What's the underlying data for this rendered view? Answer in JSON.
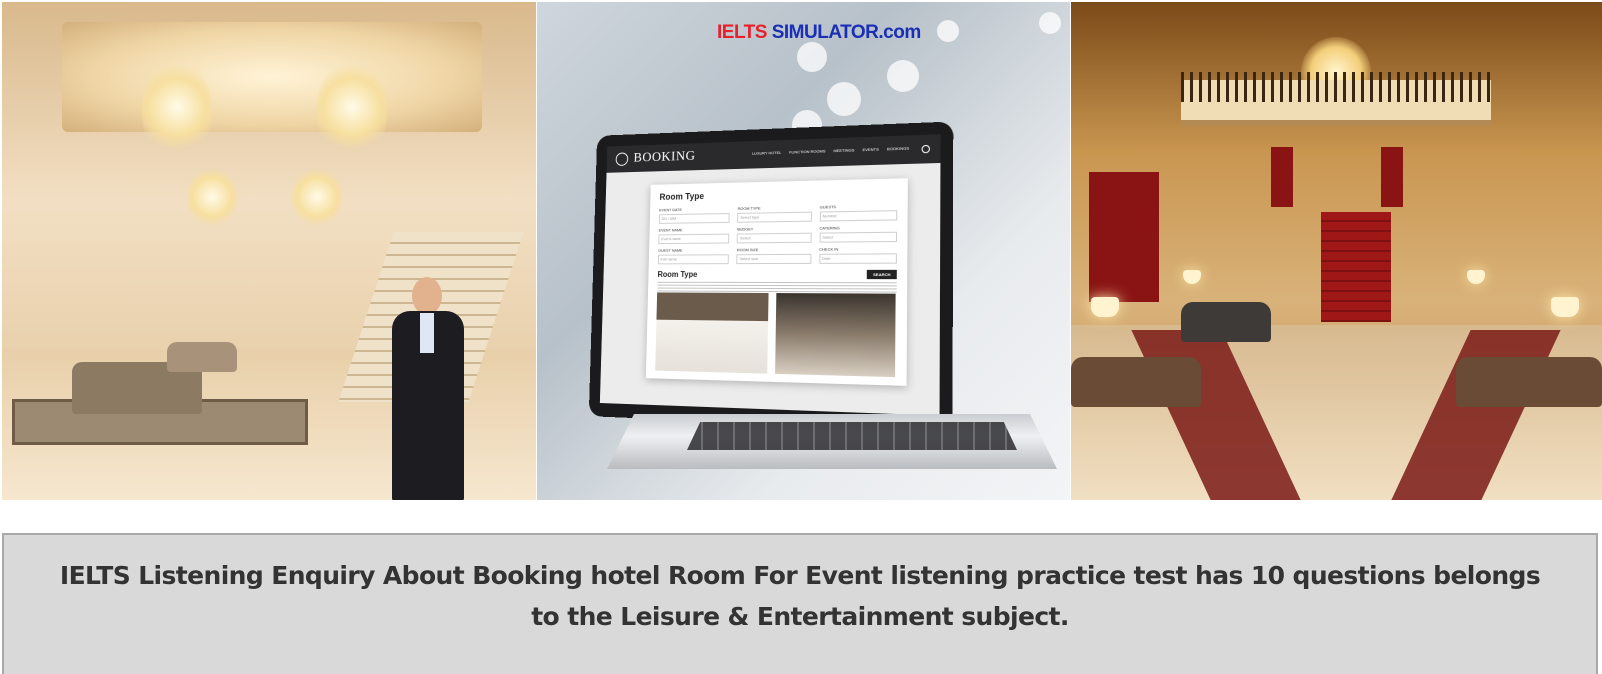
{
  "logo": {
    "part1": "IELTS",
    "part2": " SIMULATOR",
    "part3": ".com"
  },
  "laptop": {
    "brand": "BOOKING",
    "menu": [
      "LUXURY HOTEL",
      "FUNCTION ROOMS",
      "MEETINGS",
      "EVENTS",
      "BOOKINGS"
    ],
    "form_title": "Room Type",
    "fields": [
      {
        "label": "EVENT DATE",
        "value": "DD / MM"
      },
      {
        "label": "ROOM TYPE",
        "value": "Select type"
      },
      {
        "label": "GUESTS",
        "value": "Number"
      },
      {
        "label": "EVENT NAME",
        "value": "Event name"
      },
      {
        "label": "BUDGET",
        "value": "Select"
      },
      {
        "label": "CATERING",
        "value": "Select"
      },
      {
        "label": "GUEST NAME",
        "value": "Full name"
      },
      {
        "label": "ROOM SIZE",
        "value": "Select size"
      },
      {
        "label": "CHECK IN",
        "value": "Date"
      }
    ],
    "section_title": "Room Type",
    "search_button": "SEARCH"
  },
  "caption": "IELTS Listening Enquiry About Booking hotel Room For Event listening practice test has 10 questions belongs to the Leisure & Entertainment subject."
}
